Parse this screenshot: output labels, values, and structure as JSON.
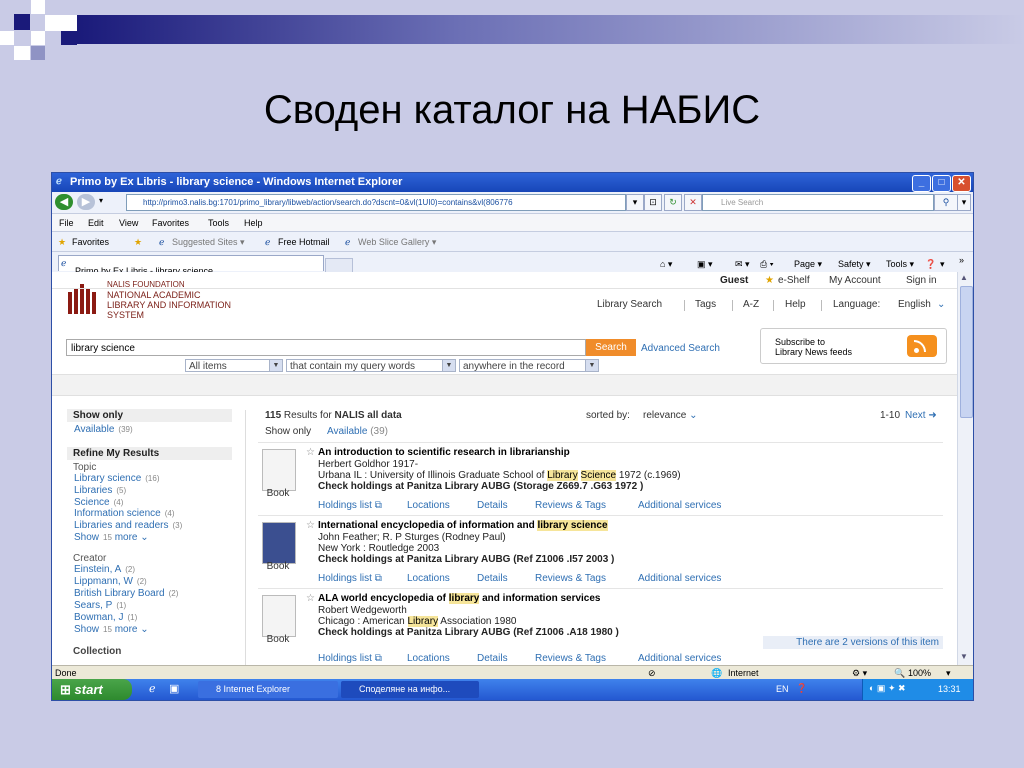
{
  "slide": {
    "title": "Своден каталог на НАБИС"
  },
  "window": {
    "title": "Primo by Ex Libris - library science - Windows Internet Explorer"
  },
  "browser": {
    "address": "http://primo3.nalis.bg:1701/primo_library/libweb/action/search.do?dscnt=0&vl(1UI0)=contains&vl(806776",
    "live_search": "Live Search",
    "menu": [
      "File",
      "Edit",
      "View",
      "Favorites",
      "Tools",
      "Help"
    ],
    "favorites": {
      "label": "Favorites",
      "suggested": "Suggested Sites ▾",
      "hotmail": "Free Hotmail",
      "webslice": "Web Slice Gallery ▾"
    },
    "tab": "Primo by Ex Libris - library science",
    "commands": {
      "page": "Page ▾",
      "safety": "Safety ▾",
      "tools": "Tools ▾",
      "help": "▾",
      "more": "»"
    }
  },
  "page": {
    "logo": {
      "line0": "NALIS FOUNDATION",
      "line1": "NATIONAL ACADEMIC",
      "line2": "LIBRARY AND INFORMATION",
      "line3": "SYSTEM"
    },
    "top_links": {
      "guest": "Guest",
      "eshelf": "e-Shelf",
      "account": "My Account",
      "signin": "Sign in"
    },
    "nav": {
      "library_search": "Library Search",
      "tags": "Tags",
      "az": "A-Z",
      "help": "Help",
      "language_label": "Language:",
      "language_value": "English"
    },
    "search": {
      "query": "library science",
      "button": "Search",
      "advanced": "Advanced Search",
      "scope": "All items",
      "precision": "that contain my query words",
      "field": "anywhere in the record"
    },
    "rss": {
      "line1": "Subscribe to",
      "line2": "Library News feeds"
    },
    "sidebar": {
      "show_only": "Show only",
      "available": {
        "label": "Available",
        "count": "(39)"
      },
      "refine": "Refine My Results",
      "topic_label": "Topic",
      "topics": [
        {
          "label": "Library science",
          "count": "(16)"
        },
        {
          "label": "Libraries",
          "count": "(5)"
        },
        {
          "label": "Science",
          "count": "(4)"
        },
        {
          "label": "Information science",
          "count": "(4)"
        },
        {
          "label": "Libraries and readers",
          "count": "(3)"
        }
      ],
      "topic_show": {
        "label": "Show",
        "num": "15",
        "more": "more ⌄"
      },
      "creator_label": "Creator",
      "creators": [
        {
          "label": "Einstein, A",
          "count": "(2)"
        },
        {
          "label": "Lippmann, W",
          "count": "(2)"
        },
        {
          "label": "British Library Board",
          "count": "(2)"
        },
        {
          "label": "Sears, P",
          "count": "(1)"
        },
        {
          "label": "Bowman, J",
          "count": "(1)"
        }
      ],
      "creator_show": {
        "label": "Show",
        "num": "15",
        "more": "more ⌄"
      },
      "collection_label": "Collection"
    },
    "results": {
      "count": "115",
      "results_for": "Results for",
      "scope": "NALIS all data",
      "sorted_label": "sorted by:",
      "sorted_value": "relevance",
      "range": "1-10",
      "next": "Next",
      "show_only": "Show only",
      "available": "Available",
      "available_count": "(39)",
      "records": [
        {
          "title": "An introduction to scientific research in librarianship",
          "author": "Herbert Goldhor 1917-",
          "pub_a": "Urbana IL : University of Illinois Graduate School of ",
          "pub_hl1": "Library",
          "pub_mid": " ",
          "pub_hl2": "Science",
          "pub_b": " 1972 (c.1969)",
          "holdings": "Check holdings at Panitza Library AUBG (Storage Z669.7 .G63 1972 )",
          "type": "Book"
        },
        {
          "title_a": "International encyclopedia of information and ",
          "title_hl": "library science",
          "author": "John Feather; R. P Sturges (Rodney Paul)",
          "pub": "New York : Routledge 2003",
          "holdings": "Check holdings at Panitza Library AUBG (Ref Z1006 .I57 2003 )",
          "type": "Book"
        },
        {
          "title_a": "ALA world encyclopedia of ",
          "title_hl": "library",
          "title_b": " and information services",
          "author": "Robert Wedgeworth",
          "pub_a": "Chicago : American ",
          "pub_hl": "Library",
          "pub_b": " Association 1980",
          "holdings": "Check holdings at Panitza Library AUBG (Ref Z1006 .A18 1980 )",
          "type": "Book",
          "versions": "There are 2 versions of this item"
        }
      ],
      "links": {
        "holdings": "Holdings list",
        "locations": "Locations",
        "details": "Details",
        "reviews": "Reviews & Tags",
        "services": "Additional services"
      }
    }
  },
  "status": {
    "done": "Done",
    "zone": "Internet",
    "zoom": "100%"
  },
  "taskbar": {
    "start": "start",
    "task1": "8 Internet Explorer",
    "task2": "Споделяне на инфо...",
    "lang": "EN",
    "clock": "13:31"
  },
  "colors": {
    "link": "#2f6fb3",
    "accent": "#f08c2a",
    "highlight": "#f6e59a",
    "titlebar": "#2458d1",
    "slide_bg": "#c9cbe6"
  }
}
